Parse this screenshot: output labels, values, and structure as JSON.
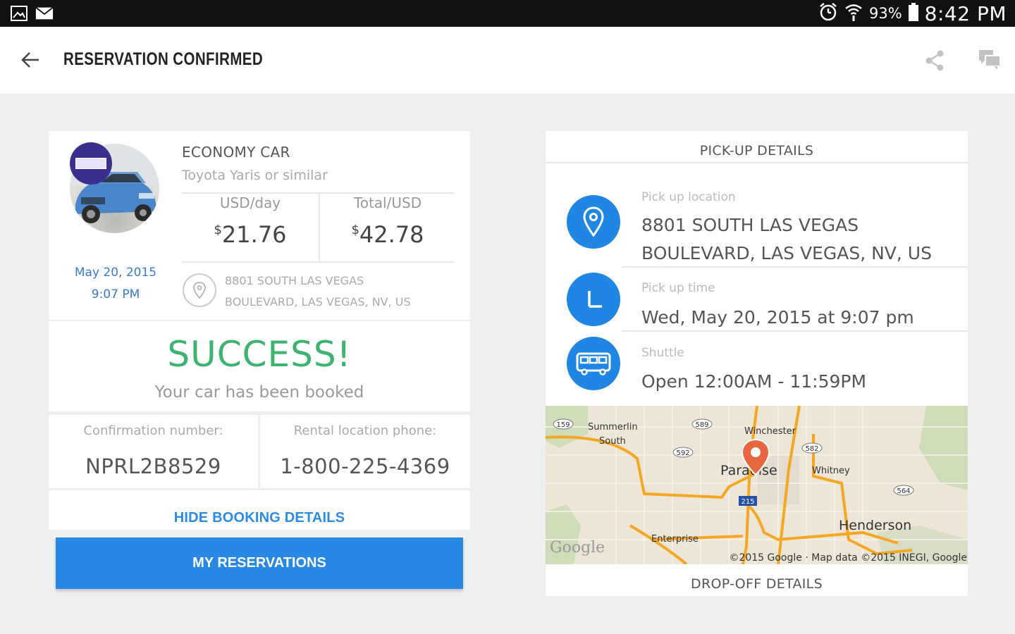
{
  "status_bar": {
    "battery_pct": "93%",
    "time": "8:42 PM"
  },
  "header": {
    "title": "RESERVATION CONFIRMED"
  },
  "car": {
    "class": "ECONOMY CAR",
    "model": "Toyota Yaris or similar",
    "date": "May 20, 2015",
    "time": "9:07 PM",
    "per_day_label": "USD/day",
    "per_day_currency": "$",
    "per_day_value": "21.76",
    "total_label": "Total/USD",
    "total_currency": "$",
    "total_value": "42.78",
    "address_line1": "8801 SOUTH LAS VEGAS",
    "address_line2": "BOULEVARD, LAS VEGAS, NV, US"
  },
  "success": {
    "title": "SUCCESS!",
    "subtitle": "Your car has been booked"
  },
  "confirmation": {
    "label": "Confirmation number:",
    "value": "NPRL2B8529"
  },
  "phone": {
    "label": "Rental location phone:",
    "value": "1-800-225-4369"
  },
  "actions": {
    "hide_details": "HIDE BOOKING DETAILS",
    "my_reservations": "MY RESERVATIONS"
  },
  "pickup": {
    "section_title": "PICK-UP DETAILS",
    "location_label": "Pick up location",
    "location_line1": "8801 SOUTH LAS VEGAS",
    "location_line2": "BOULEVARD, LAS VEGAS, NV, US",
    "time_label": "Pick up time",
    "time_value": "Wed, May 20, 2015 at 9:07 pm",
    "shuttle_label": "Shuttle",
    "shuttle_value": "Open 12:00AM - 11:59PM"
  },
  "map": {
    "labels": {
      "summerlin": "Summerlin",
      "south": "South",
      "winchester": "Winchester",
      "paradise": "Paradise",
      "whitney": "Whitney",
      "henderson": "Henderson",
      "enterprise": "Enterprise",
      "google": "Google",
      "attribution": "©2015 Google · Map data ©2015 INEGI, Google"
    },
    "shields": {
      "r159": "159",
      "r589": "589",
      "r592": "592",
      "r582": "582",
      "r564": "564",
      "i215": "215"
    }
  },
  "dropoff": {
    "section_title": "DROP-OFF DETAILS"
  }
}
